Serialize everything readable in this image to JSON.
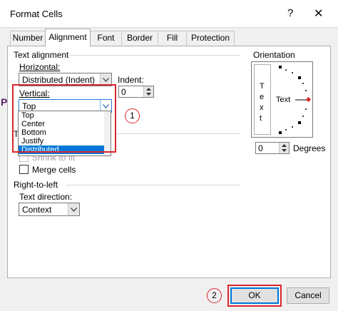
{
  "window": {
    "title": "Format Cells",
    "help_glyph": "?",
    "close_glyph": "✕"
  },
  "tabs": [
    {
      "label": "Number"
    },
    {
      "label": "Alignment"
    },
    {
      "label": "Font"
    },
    {
      "label": "Border"
    },
    {
      "label": "Fill"
    },
    {
      "label": "Protection"
    }
  ],
  "text_alignment": {
    "section_title": "Text alignment",
    "horizontal_label": "Horizontal:",
    "horizontal_value": "Distributed (Indent)",
    "indent_label": "Indent:",
    "indent_value": "0",
    "vertical_label": "Vertical:",
    "vertical_value": "Top",
    "vertical_options": [
      "Top",
      "Center",
      "Bottom",
      "Justify",
      "Distributed"
    ],
    "vertical_selected_index": 4
  },
  "text_control": {
    "hidden_title_fragment": "Te",
    "shrink_label": "Shrink to fit",
    "merge_label": "Merge cells"
  },
  "right_to_left": {
    "section_title": "Right-to-left",
    "direction_label": "Text direction:",
    "direction_value": "Context"
  },
  "orientation": {
    "section_title": "Orientation",
    "vertical_letters": [
      "T",
      "e",
      "x",
      "t"
    ],
    "dial_text": "Text",
    "degrees_value": "0",
    "degrees_label": "Degrees"
  },
  "annotations": {
    "callout_1": "1",
    "callout_2": "2",
    "color": "#d9262c"
  },
  "buttons": {
    "ok": "OK",
    "cancel": "Cancel"
  },
  "background_bleed": {
    "left_char": "P"
  }
}
